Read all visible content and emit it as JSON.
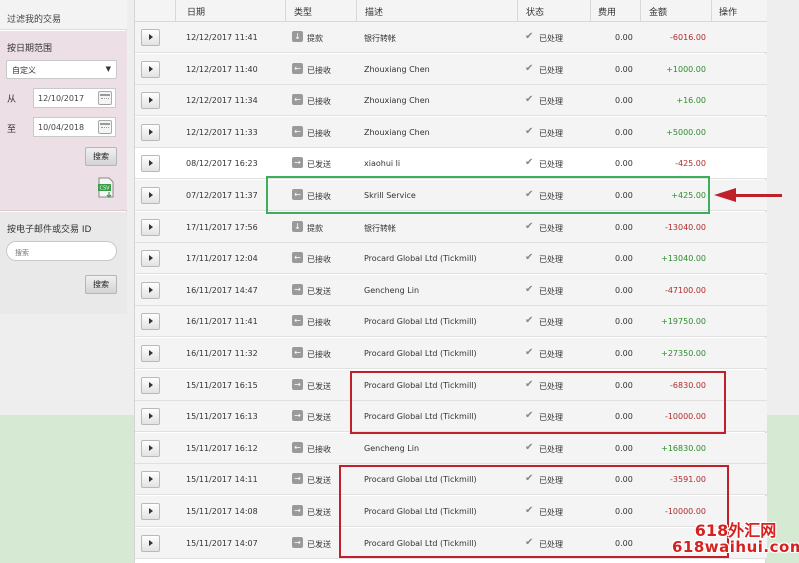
{
  "sidebar": {
    "title": "过滤我的交易",
    "date_range_label": "按日期范围",
    "range_select": "自定义",
    "from_label": "从",
    "from_date": "12/10/2017",
    "to_label": "至",
    "to_date": "10/04/2018",
    "search_button": "搜索",
    "email_label": "按电子邮件或交易 ID",
    "email_placeholder": "搜索",
    "email_search_button": "搜索"
  },
  "table": {
    "headers": [
      "日期",
      "类型",
      "描述",
      "状态",
      "费用",
      "金额",
      "操作"
    ],
    "rows": [
      {
        "date": "12/12/2017 11:41",
        "type": "提款",
        "type_icon": "withdraw-icon",
        "desc": "银行转帐",
        "status": "已处理",
        "fee": "0.00",
        "amount": "-6016.00",
        "sign": "neg"
      },
      {
        "date": "12/12/2017 11:40",
        "type": "已接收",
        "type_icon": "receive-icon",
        "desc": "Zhouxiang Chen",
        "status": "已处理",
        "fee": "0.00",
        "amount": "+1000.00",
        "sign": "pos"
      },
      {
        "date": "12/12/2017 11:34",
        "type": "已接收",
        "type_icon": "receive-icon",
        "desc": "Zhouxiang Chen",
        "status": "已处理",
        "fee": "0.00",
        "amount": "+16.00",
        "sign": "pos"
      },
      {
        "date": "12/12/2017 11:33",
        "type": "已接收",
        "type_icon": "receive-icon",
        "desc": "Zhouxiang Chen",
        "status": "已处理",
        "fee": "0.00",
        "amount": "+5000.00",
        "sign": "pos"
      },
      {
        "date": "08/12/2017 16:23",
        "type": "已发送",
        "type_icon": "send-icon",
        "desc": "xiaohui li",
        "status": "已处理",
        "fee": "0.00",
        "amount": "-425.00",
        "sign": "neg"
      },
      {
        "date": "07/12/2017 11:37",
        "type": "已接收",
        "type_icon": "receive-icon",
        "desc": "Skrill Service",
        "status": "已处理",
        "fee": "0.00",
        "amount": "+425.00",
        "sign": "pos"
      },
      {
        "date": "17/11/2017 17:56",
        "type": "提款",
        "type_icon": "withdraw-icon",
        "desc": "银行转帐",
        "status": "已处理",
        "fee": "0.00",
        "amount": "-13040.00",
        "sign": "neg"
      },
      {
        "date": "17/11/2017 12:04",
        "type": "已接收",
        "type_icon": "receive-icon",
        "desc": "Procard Global Ltd (Tickmill)",
        "status": "已处理",
        "fee": "0.00",
        "amount": "+13040.00",
        "sign": "pos"
      },
      {
        "date": "16/11/2017 14:47",
        "type": "已发送",
        "type_icon": "send-icon",
        "desc": "Gencheng Lin",
        "status": "已处理",
        "fee": "0.00",
        "amount": "-47100.00",
        "sign": "neg"
      },
      {
        "date": "16/11/2017 11:41",
        "type": "已接收",
        "type_icon": "receive-icon",
        "desc": "Procard Global Ltd (Tickmill)",
        "status": "已处理",
        "fee": "0.00",
        "amount": "+19750.00",
        "sign": "pos"
      },
      {
        "date": "16/11/2017 11:32",
        "type": "已接收",
        "type_icon": "receive-icon",
        "desc": "Procard Global Ltd (Tickmill)",
        "status": "已处理",
        "fee": "0.00",
        "amount": "+27350.00",
        "sign": "pos"
      },
      {
        "date": "15/11/2017 16:15",
        "type": "已发送",
        "type_icon": "send-icon",
        "desc": "Procard Global Ltd (Tickmill)",
        "status": "已处理",
        "fee": "0.00",
        "amount": "-6830.00",
        "sign": "neg"
      },
      {
        "date": "15/11/2017 16:13",
        "type": "已发送",
        "type_icon": "send-icon",
        "desc": "Procard Global Ltd (Tickmill)",
        "status": "已处理",
        "fee": "0.00",
        "amount": "-10000.00",
        "sign": "neg"
      },
      {
        "date": "15/11/2017 16:12",
        "type": "已接收",
        "type_icon": "receive-icon",
        "desc": "Gencheng Lin",
        "status": "已处理",
        "fee": "0.00",
        "amount": "+16830.00",
        "sign": "pos"
      },
      {
        "date": "15/11/2017 14:11",
        "type": "已发送",
        "type_icon": "send-icon",
        "desc": "Procard Global Ltd (Tickmill)",
        "status": "已处理",
        "fee": "0.00",
        "amount": "-3591.00",
        "sign": "neg"
      },
      {
        "date": "15/11/2017 14:08",
        "type": "已发送",
        "type_icon": "send-icon",
        "desc": "Procard Global Ltd (Tickmill)",
        "status": "已处理",
        "fee": "0.00",
        "amount": "-10000.00",
        "sign": "neg"
      },
      {
        "date": "15/11/2017 14:07",
        "type": "已发送",
        "type_icon": "send-icon",
        "desc": "Procard Global Ltd (Tickmill)",
        "status": "已处理",
        "fee": "0.00",
        "amount": "-",
        "sign": "neg"
      }
    ]
  },
  "colors": {
    "negative": "#b02a2a",
    "positive": "#2e8b2e",
    "annotation_green": "#3fae5b",
    "annotation_red": "#c0202a"
  },
  "watermark": {
    "line1": "618外汇网",
    "line2": "618waihui.com"
  }
}
